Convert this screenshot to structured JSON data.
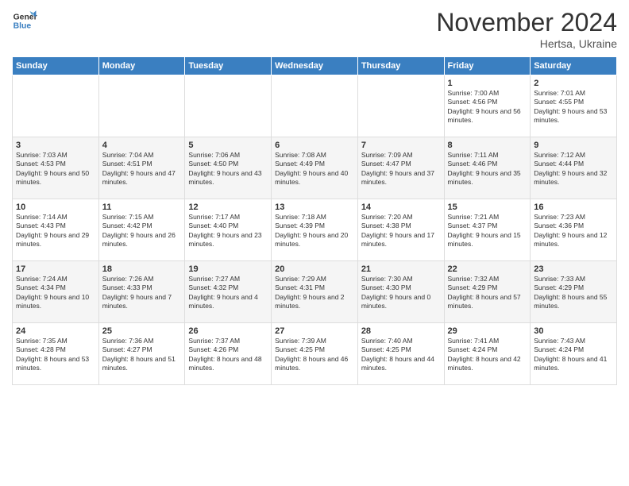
{
  "logo": {
    "line1": "General",
    "line2": "Blue"
  },
  "title": "November 2024",
  "subtitle": "Hertsa, Ukraine",
  "days_of_week": [
    "Sunday",
    "Monday",
    "Tuesday",
    "Wednesday",
    "Thursday",
    "Friday",
    "Saturday"
  ],
  "weeks": [
    [
      {
        "day": "",
        "info": ""
      },
      {
        "day": "",
        "info": ""
      },
      {
        "day": "",
        "info": ""
      },
      {
        "day": "",
        "info": ""
      },
      {
        "day": "",
        "info": ""
      },
      {
        "day": "1",
        "info": "Sunrise: 7:00 AM\nSunset: 4:56 PM\nDaylight: 9 hours and 56 minutes."
      },
      {
        "day": "2",
        "info": "Sunrise: 7:01 AM\nSunset: 4:55 PM\nDaylight: 9 hours and 53 minutes."
      }
    ],
    [
      {
        "day": "3",
        "info": "Sunrise: 7:03 AM\nSunset: 4:53 PM\nDaylight: 9 hours and 50 minutes."
      },
      {
        "day": "4",
        "info": "Sunrise: 7:04 AM\nSunset: 4:51 PM\nDaylight: 9 hours and 47 minutes."
      },
      {
        "day": "5",
        "info": "Sunrise: 7:06 AM\nSunset: 4:50 PM\nDaylight: 9 hours and 43 minutes."
      },
      {
        "day": "6",
        "info": "Sunrise: 7:08 AM\nSunset: 4:49 PM\nDaylight: 9 hours and 40 minutes."
      },
      {
        "day": "7",
        "info": "Sunrise: 7:09 AM\nSunset: 4:47 PM\nDaylight: 9 hours and 37 minutes."
      },
      {
        "day": "8",
        "info": "Sunrise: 7:11 AM\nSunset: 4:46 PM\nDaylight: 9 hours and 35 minutes."
      },
      {
        "day": "9",
        "info": "Sunrise: 7:12 AM\nSunset: 4:44 PM\nDaylight: 9 hours and 32 minutes."
      }
    ],
    [
      {
        "day": "10",
        "info": "Sunrise: 7:14 AM\nSunset: 4:43 PM\nDaylight: 9 hours and 29 minutes."
      },
      {
        "day": "11",
        "info": "Sunrise: 7:15 AM\nSunset: 4:42 PM\nDaylight: 9 hours and 26 minutes."
      },
      {
        "day": "12",
        "info": "Sunrise: 7:17 AM\nSunset: 4:40 PM\nDaylight: 9 hours and 23 minutes."
      },
      {
        "day": "13",
        "info": "Sunrise: 7:18 AM\nSunset: 4:39 PM\nDaylight: 9 hours and 20 minutes."
      },
      {
        "day": "14",
        "info": "Sunrise: 7:20 AM\nSunset: 4:38 PM\nDaylight: 9 hours and 17 minutes."
      },
      {
        "day": "15",
        "info": "Sunrise: 7:21 AM\nSunset: 4:37 PM\nDaylight: 9 hours and 15 minutes."
      },
      {
        "day": "16",
        "info": "Sunrise: 7:23 AM\nSunset: 4:36 PM\nDaylight: 9 hours and 12 minutes."
      }
    ],
    [
      {
        "day": "17",
        "info": "Sunrise: 7:24 AM\nSunset: 4:34 PM\nDaylight: 9 hours and 10 minutes."
      },
      {
        "day": "18",
        "info": "Sunrise: 7:26 AM\nSunset: 4:33 PM\nDaylight: 9 hours and 7 minutes."
      },
      {
        "day": "19",
        "info": "Sunrise: 7:27 AM\nSunset: 4:32 PM\nDaylight: 9 hours and 4 minutes."
      },
      {
        "day": "20",
        "info": "Sunrise: 7:29 AM\nSunset: 4:31 PM\nDaylight: 9 hours and 2 minutes."
      },
      {
        "day": "21",
        "info": "Sunrise: 7:30 AM\nSunset: 4:30 PM\nDaylight: 9 hours and 0 minutes."
      },
      {
        "day": "22",
        "info": "Sunrise: 7:32 AM\nSunset: 4:29 PM\nDaylight: 8 hours and 57 minutes."
      },
      {
        "day": "23",
        "info": "Sunrise: 7:33 AM\nSunset: 4:29 PM\nDaylight: 8 hours and 55 minutes."
      }
    ],
    [
      {
        "day": "24",
        "info": "Sunrise: 7:35 AM\nSunset: 4:28 PM\nDaylight: 8 hours and 53 minutes."
      },
      {
        "day": "25",
        "info": "Sunrise: 7:36 AM\nSunset: 4:27 PM\nDaylight: 8 hours and 51 minutes."
      },
      {
        "day": "26",
        "info": "Sunrise: 7:37 AM\nSunset: 4:26 PM\nDaylight: 8 hours and 48 minutes."
      },
      {
        "day": "27",
        "info": "Sunrise: 7:39 AM\nSunset: 4:25 PM\nDaylight: 8 hours and 46 minutes."
      },
      {
        "day": "28",
        "info": "Sunrise: 7:40 AM\nSunset: 4:25 PM\nDaylight: 8 hours and 44 minutes."
      },
      {
        "day": "29",
        "info": "Sunrise: 7:41 AM\nSunset: 4:24 PM\nDaylight: 8 hours and 42 minutes."
      },
      {
        "day": "30",
        "info": "Sunrise: 7:43 AM\nSunset: 4:24 PM\nDaylight: 8 hours and 41 minutes."
      }
    ]
  ]
}
